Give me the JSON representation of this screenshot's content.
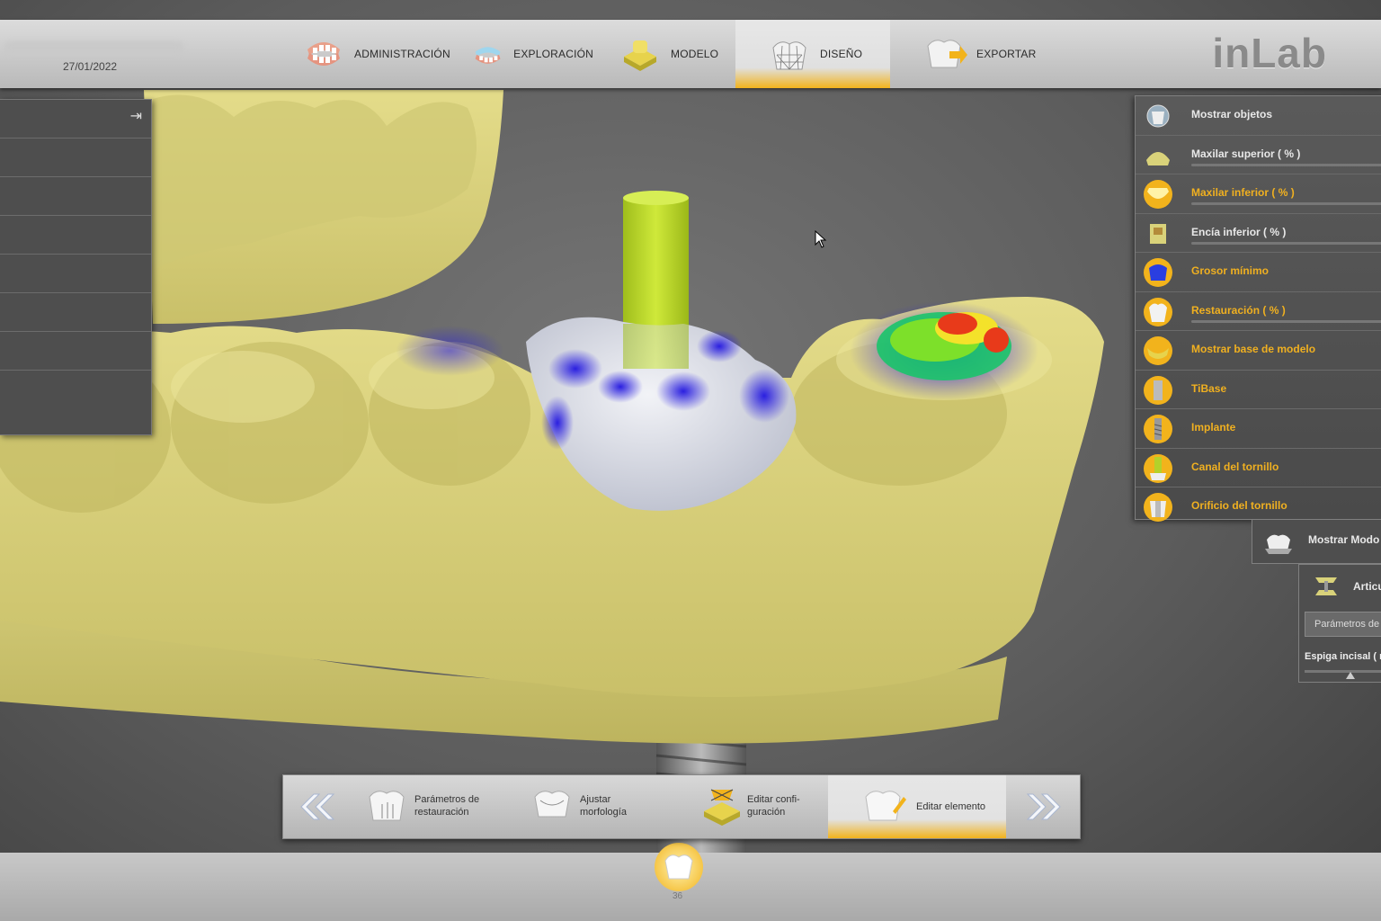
{
  "header": {
    "date": "27/01/2022",
    "logo": "inLab",
    "steps": [
      {
        "label": "ADMINISTRACIÓN",
        "icon": "jaw-icon"
      },
      {
        "label": "EXPLORACIÓN",
        "icon": "scan-jaw-icon"
      },
      {
        "label": "MODELO",
        "icon": "model-icon"
      },
      {
        "label": "DISEÑO",
        "icon": "crown-mesh-icon",
        "active": true
      },
      {
        "label": "EXPORTAR",
        "icon": "export-icon"
      }
    ]
  },
  "objects_panel": {
    "items": [
      {
        "label": "Mostrar objetos",
        "icon": "show-objects-icon",
        "slider": false,
        "color": "white"
      },
      {
        "label": "Maxilar superior  ( % )",
        "icon": "upper-jaw-icon",
        "slider": true,
        "color": "white"
      },
      {
        "label": "Maxilar inferior  ( % )",
        "icon": "lower-jaw-icon",
        "slider": true,
        "color": "yellow"
      },
      {
        "label": "Encía inferior  ( % )",
        "icon": "gingiva-icon",
        "slider": true,
        "color": "white"
      },
      {
        "label": "Grosor mínimo",
        "icon": "min-thickness-icon",
        "slider": false,
        "color": "yellow"
      },
      {
        "label": "Restauración  ( % )",
        "icon": "restoration-icon",
        "slider": true,
        "color": "yellow"
      },
      {
        "label": "Mostrar base de modelo",
        "icon": "model-base-icon",
        "slider": false,
        "color": "yellow"
      },
      {
        "label": "TiBase",
        "icon": "tibase-icon",
        "slider": false,
        "color": "yellow"
      },
      {
        "label": "Implante",
        "icon": "implant-icon",
        "slider": false,
        "color": "yellow"
      },
      {
        "label": "Canal del tornillo",
        "icon": "screw-channel-icon",
        "slider": false,
        "color": "yellow"
      },
      {
        "label": "Orificio del tornillo",
        "icon": "screw-hole-icon",
        "slider": false,
        "color": "yellow"
      }
    ],
    "show_mode": "Mostrar Modo",
    "articulator": "Articu",
    "params_button": "Parámetros de",
    "incisal_pin": "Espiga incisal ( m"
  },
  "toolbar": {
    "prev_icon": "double-chevron-left-icon",
    "next_icon": "double-chevron-right-icon",
    "steps": [
      {
        "line1": "Parámetros de",
        "line2": "restauración",
        "icon": "restoration-params-icon"
      },
      {
        "line1": "Ajustar",
        "line2": "morfología",
        "icon": "morphology-icon"
      },
      {
        "line1": "Editar confi-",
        "line2": "guración",
        "icon": "config-icon"
      },
      {
        "line1": "Editar elemento",
        "line2": "",
        "icon": "edit-element-icon",
        "active": true
      }
    ]
  },
  "tooth": {
    "number": "36"
  },
  "colors": {
    "model": "#d9d27a",
    "accent": "#f2b31c",
    "crown": "#d6d9e4",
    "contact": "#3a2ce6",
    "channel": "#b4d12a"
  }
}
